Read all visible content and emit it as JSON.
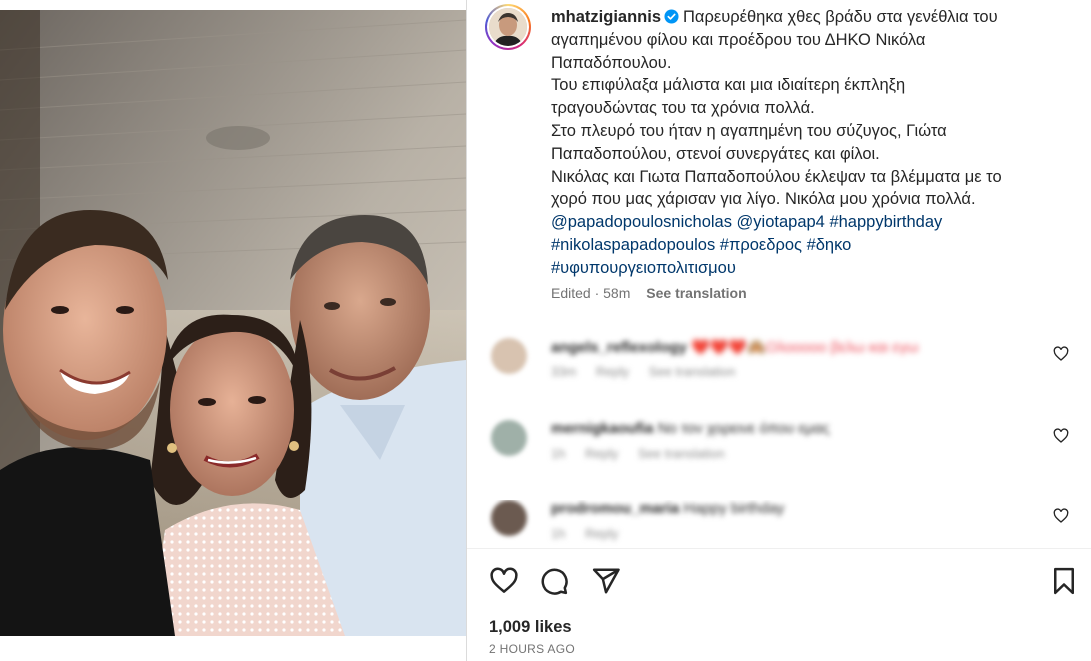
{
  "post": {
    "username": "mhatzigiannis",
    "caption_lines": [
      "Παρευρέθηκα χθες βράδυ στα γενέθλια του",
      "αγαπημένου φίλου και προέδρου του ΔΗΚΟ Νικόλα",
      "Παπαδόπουλου.",
      "Του επιφύλαξα μάλιστα και μια ιδιαίτερη έκπληξη",
      "τραγουδώντας του τα χρόνια πολλά.",
      "Στο πλευρό του ήταν η αγαπημένη του σύζυγος, Γιώτα",
      "Παπαδοπούλου, στενοί συνεργάτες και φίλοι.",
      "Νικόλας και Γιωτα Παπαδοπούλου έκλεψαν τα βλέμματα με το",
      "χορό που μας χάρισαν για λίγο. Νικόλα μου χρόνια πολλά."
    ],
    "tags_line1": "@papadopoulosnicholas @yiotapap4 #happybirthday",
    "tags_line2": "#nikolaspapadopoulos #προεδρος #δηκο",
    "tags_line3": "#υφυπουργειοπολιτισμου",
    "edited": "Edited · 58m",
    "see_translation": "See translation"
  },
  "comments": [
    {
      "username": "angels_reflexology",
      "text": "❤️❤️❤️🙈Ολοοοοο βελω και εγω",
      "time": "33m",
      "reply": "Reply",
      "see_translation": "See translation"
    },
    {
      "username": "mernigkaoufia",
      "text": "Νο τον χορεινε όπου εμας",
      "time": "1h",
      "reply": "Reply",
      "see_translation": "See translation"
    },
    {
      "username": "prodromou_maria",
      "text": "Happy birthday",
      "time": "1h",
      "reply": "Reply"
    }
  ],
  "stats": {
    "likes": "1,009 likes",
    "time_ago": "2 HOURS AGO"
  },
  "colors": {
    "link": "#00376b",
    "verified": "#0095f6",
    "muted": "#737373"
  }
}
